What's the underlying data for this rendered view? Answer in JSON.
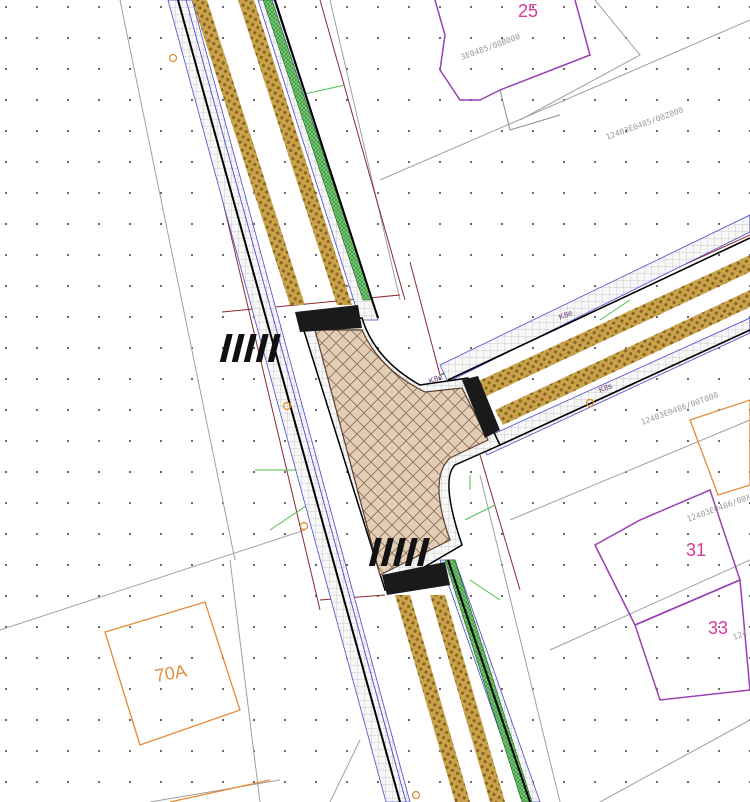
{
  "map": {
    "colors": {
      "background": "#ffffff",
      "grid_dot": "#5a5a5a",
      "parcel_line": "#a0a0a0",
      "property_line": "#8b2a2a",
      "road_edge": "#000000",
      "road_edge_blue": "#4a4ad0",
      "sidewalk_grid": "#bdbdbd",
      "tree_strip": "#b8923a",
      "tree_dark": "#7a5a1c",
      "green_strip": "#3c9a3c",
      "paving": "#d8c0a8",
      "paving_line": "#8a6a50",
      "crossing_bar": "#111111",
      "building_purple": "#9b3fb4",
      "building_orange": "#e28b3a",
      "house_number": "#d63a9a",
      "green_line": "#4fbf4f",
      "cadastral_text": "#9a9a9a",
      "orange_marker": "#e08a2a"
    },
    "house_numbers": [
      {
        "id": "n25",
        "text": "25"
      },
      {
        "id": "n31",
        "text": "31"
      },
      {
        "id": "n33",
        "text": "33"
      },
      {
        "id": "n70a",
        "text": "70A"
      }
    ],
    "cadastral_refs": [
      {
        "id": "c1",
        "text": "3E0485/00B000"
      },
      {
        "id": "c2",
        "text": "12403E0485/00Z000"
      },
      {
        "id": "c3",
        "text": "12403E0486/00T000"
      },
      {
        "id": "c4",
        "text": "12403E0486/00X0"
      },
      {
        "id": "c5",
        "text": "124"
      }
    ],
    "road_tags": [
      {
        "id": "t1",
        "text": "K8e"
      },
      {
        "id": "t2",
        "text": "K8e"
      },
      {
        "id": "t3",
        "text": "K8s"
      }
    ]
  }
}
